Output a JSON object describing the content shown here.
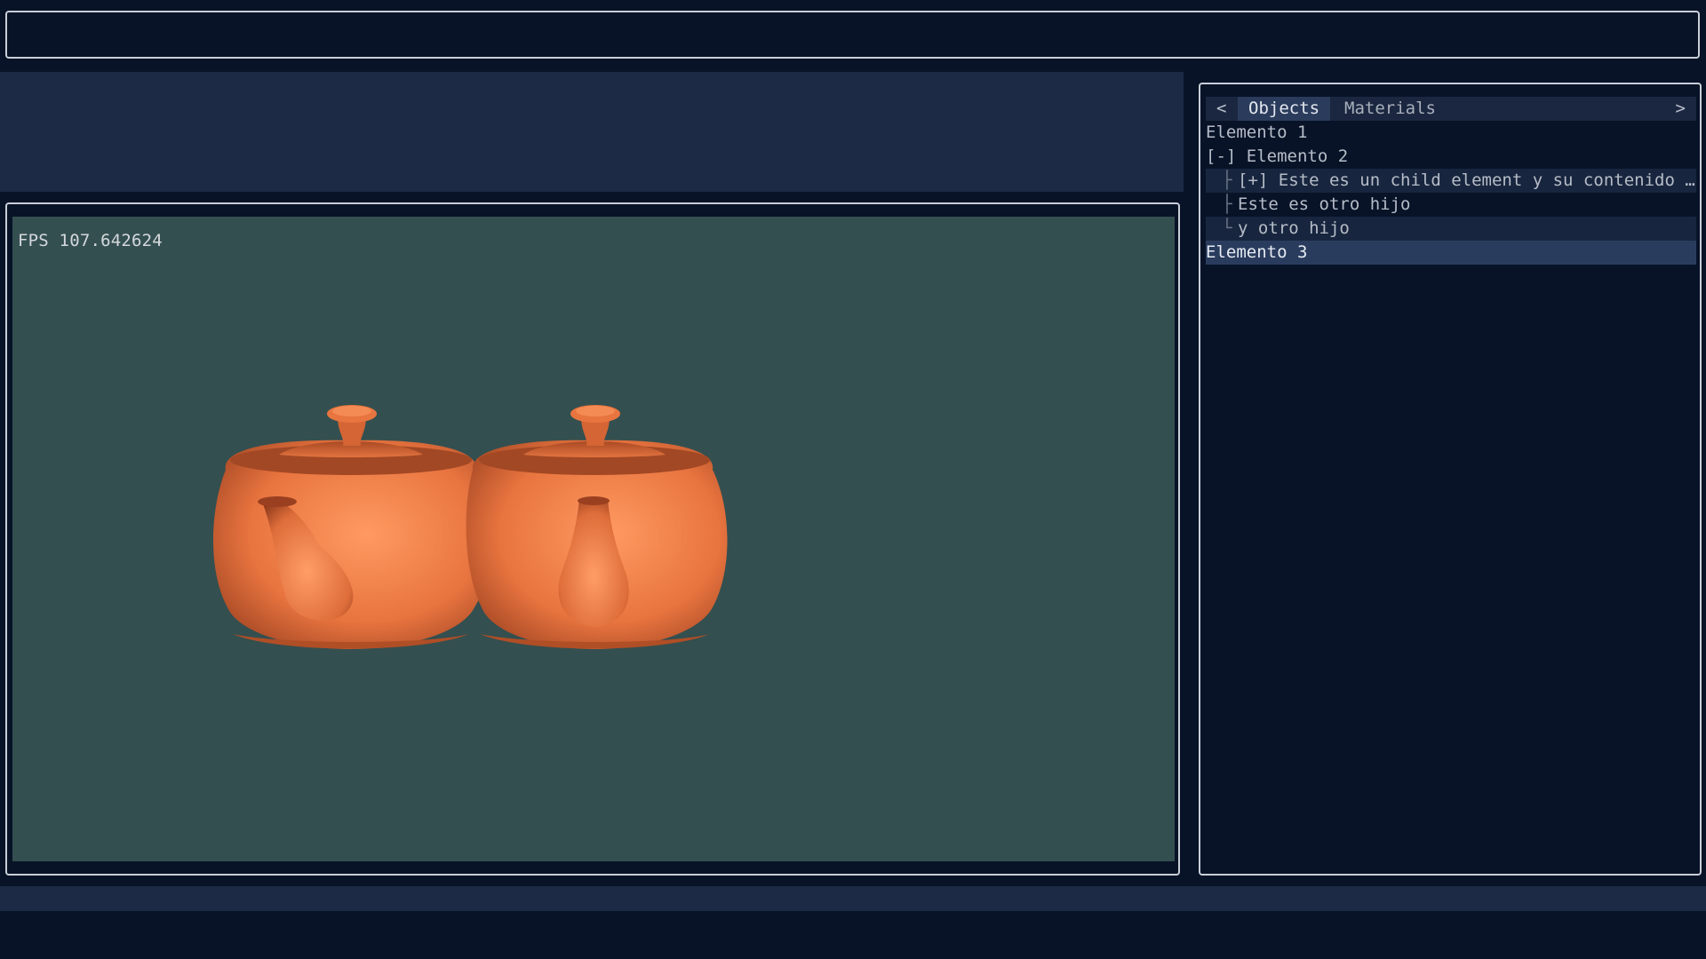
{
  "viewport": {
    "fps_text": "FPS 107.642624",
    "background_color": "#344f4f",
    "teapot_color": "#e57a4b"
  },
  "side_panel": {
    "tabs": {
      "prev_arrow": "<",
      "next_arrow": ">",
      "items": [
        "Objects",
        "Materials"
      ],
      "active": "Objects"
    },
    "tree": [
      {
        "prefix": "",
        "label": "Elemento 1",
        "level": 0
      },
      {
        "prefix": "[-] ",
        "label": "Elemento 2",
        "level": 0
      },
      {
        "prefix": "[+] ",
        "label": "Este es un child element y su contenido es muy largo",
        "level": 1,
        "guide": "├"
      },
      {
        "prefix": "",
        "label": "Este es otro hijo",
        "level": 1,
        "guide": "├"
      },
      {
        "prefix": "",
        "label": "y otro hijo",
        "level": 1,
        "guide": "└"
      },
      {
        "prefix": "",
        "label": "Elemento 3",
        "level": 0,
        "selected": true
      }
    ]
  }
}
